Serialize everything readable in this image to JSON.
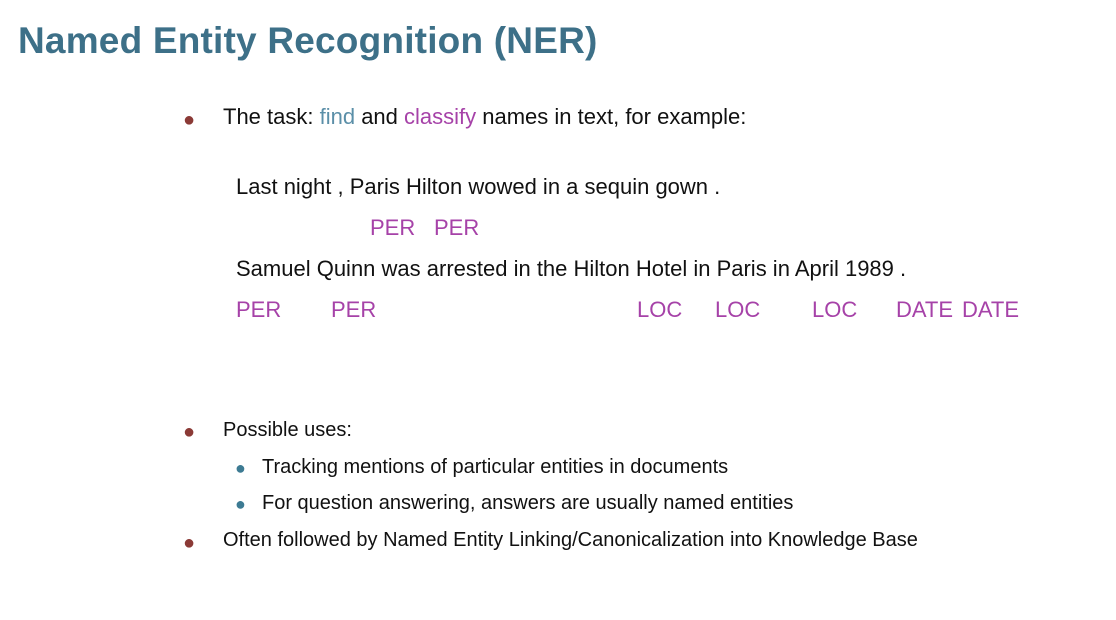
{
  "slide": {
    "title": "Named Entity Recognition (NER)"
  },
  "task_bullet": {
    "prefix": "The task: ",
    "find": "find",
    "and": " and ",
    "classify": "classify",
    "suffix": " names in text, for example:"
  },
  "examples": {
    "sentence1": "Last night , Paris Hilton wowed in a sequin gown .",
    "sentence1_tags": [
      "PER",
      "PER"
    ],
    "sentence2": "Samuel Quinn was arrested in the Hilton Hotel in Paris in April 1989 .",
    "sentence2_tags": [
      "PER",
      "PER",
      "LOC",
      "LOC",
      "LOC",
      "DATE",
      "DATE"
    ]
  },
  "uses": {
    "heading": "Possible uses:",
    "items": [
      "Tracking mentions of particular entities in documents",
      "For question answering, answers are usually named entities"
    ]
  },
  "linking_bullet": "Often followed by Named Entity Linking/Canonicalization into Knowledge Base",
  "colors": {
    "title": "#3d7088",
    "find": "#5b8fa8",
    "classify": "#a642a8",
    "tag": "#a642a8",
    "main_bullet": "#8b3a36",
    "sub_bullet": "#3d7b93"
  }
}
